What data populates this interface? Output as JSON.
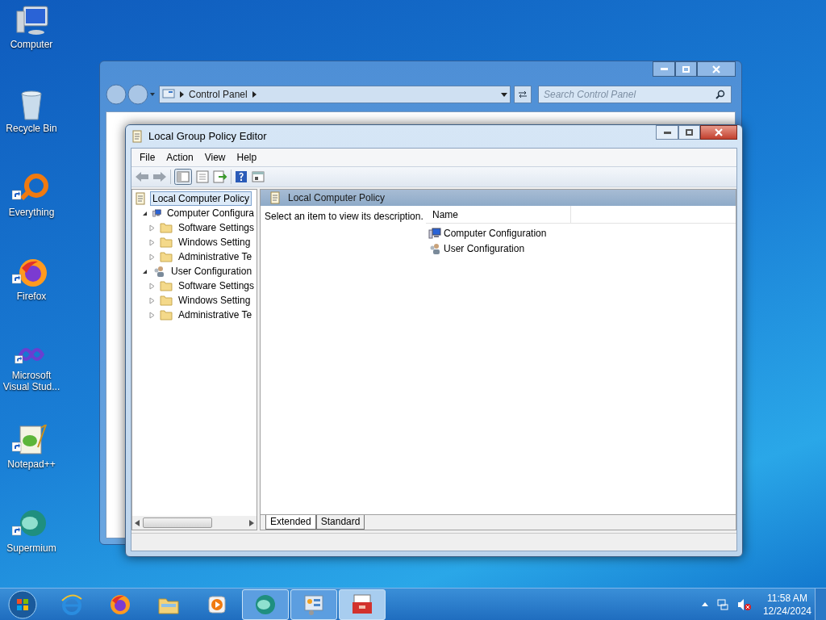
{
  "desktop_icons": [
    {
      "label": "Computer",
      "kind": "computer"
    },
    {
      "label": "Recycle Bin",
      "kind": "bin"
    },
    {
      "label": "Everything",
      "kind": "ring"
    },
    {
      "label": "Firefox",
      "kind": "fox"
    },
    {
      "label": "Microsoft Visual Stud...",
      "kind": "infinity"
    },
    {
      "label": "Notepad++",
      "kind": "notepad"
    },
    {
      "label": "Supermium",
      "kind": "orb"
    }
  ],
  "control_panel": {
    "breadcrumb": "Control Panel",
    "search": {
      "placeholder": "Search Control Panel"
    }
  },
  "editor": {
    "title": "Local Group Policy Editor",
    "menu": [
      "File",
      "Action",
      "View",
      "Help"
    ],
    "tree": [
      {
        "label": "Local Computer Policy",
        "kind": "policy",
        "selected": true,
        "children": [
          {
            "label": "Computer Configura",
            "kind": "computer",
            "selected": false,
            "expanded": true,
            "children": [
              {
                "label": "Software Settings",
                "kind": "folder",
                "selected": false,
                "expanded": false
              },
              {
                "label": "Windows Setting",
                "kind": "folder",
                "selected": false,
                "expanded": false
              },
              {
                "label": "Administrative Te",
                "kind": "folder",
                "selected": false,
                "expanded": false
              }
            ]
          },
          {
            "label": "User Configuration",
            "kind": "user",
            "selected": false,
            "expanded": true,
            "children": [
              {
                "label": "Software Settings",
                "kind": "folder",
                "selected": false,
                "expanded": false
              },
              {
                "label": "Windows Setting",
                "kind": "folder",
                "selected": false,
                "expanded": false
              },
              {
                "label": "Administrative Te",
                "kind": "folder",
                "selected": false,
                "expanded": false
              }
            ]
          }
        ]
      }
    ],
    "header": "Local Computer Policy",
    "description": "Select an item to view its description.",
    "columns": [
      "Name"
    ],
    "items": [
      {
        "label": "Computer Configuration",
        "kind": "computer"
      },
      {
        "label": "User Configuration",
        "kind": "user"
      }
    ],
    "tabs": [
      {
        "label": "Extended",
        "selected": true
      },
      {
        "label": "Standard",
        "selected": false
      }
    ]
  },
  "taskbar": {
    "apps": [
      {
        "kind": "ie",
        "running": false,
        "selected": false
      },
      {
        "kind": "fox",
        "running": false,
        "selected": false
      },
      {
        "kind": "explorer",
        "running": false,
        "selected": false
      },
      {
        "kind": "player",
        "running": false,
        "selected": false
      },
      {
        "kind": "orb",
        "running": true,
        "selected": false
      },
      {
        "kind": "panel",
        "running": true,
        "selected": false
      },
      {
        "kind": "toolbox",
        "running": true,
        "selected": true
      }
    ],
    "time": "11:58 AM",
    "date": "12/24/2024"
  }
}
